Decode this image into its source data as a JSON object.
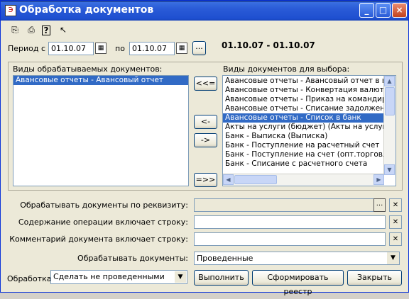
{
  "window": {
    "title": "Обработка документов"
  },
  "titlebar_buttons": {
    "minimize": "_",
    "maximize": "□",
    "close": "×"
  },
  "toolbar": {
    "icons": [
      "open-icon",
      "save-icon",
      "help-icon",
      "whatsthis-icon"
    ],
    "glyphs": [
      "⎘",
      "⎙",
      "?",
      "↖"
    ]
  },
  "period": {
    "label_from": "Период с",
    "from": "01.10.07",
    "label_to": "по",
    "to": "01.10.07",
    "ellipsis": "...",
    "summary": "01.10.07 - 01.10.07"
  },
  "left_list": {
    "header": "Виды обрабатываемых документов:",
    "items": [
      "Авансовые отчеты - Авансовый отчет"
    ],
    "selected": 0
  },
  "right_list": {
    "header": "Виды документов для выбора:",
    "items": [
      "Авансовые отчеты - Авансовый отчет в валю",
      "Авансовые отчеты - Конвертация валюты по",
      "Авансовые отчеты - Приказ на командиров",
      "Авансовые отчеты - Списание задолженност",
      "Авансовые отчеты - Список в банк",
      "Акты на услуги (бюджет) (Акты на услуги по",
      "Банк - Выписка (Выписка)",
      "Банк - Поступление на расчетный счет",
      "Банк - Поступление на счет (опт.торговля)",
      "Банк - Списание с расчетного счета"
    ],
    "selected": 4
  },
  "move_buttons": {
    "all_left": "<<=",
    "one_left": "<-",
    "one_right": "->",
    "all_right": "=>>"
  },
  "form": {
    "by_requisite_label": "Обрабатывать документы по реквизиту:",
    "by_requisite_value": "",
    "operation_label": "Содержание операции включает строку:",
    "operation_value": "",
    "comment_label": "Комментарий документа включает строку:",
    "comment_value": "",
    "process_docs_label": "Обрабатывать документы:",
    "process_docs_value": "Проведенные",
    "clear_glyph": "✕",
    "dots": "...",
    "dropdown_glyph": "▼"
  },
  "footer": {
    "processing_label": "Обработка:",
    "processing_value": "Сделать не проведенными",
    "execute": "Выполнить",
    "registry": "Сформировать реестр",
    "close": "Закрыть"
  }
}
